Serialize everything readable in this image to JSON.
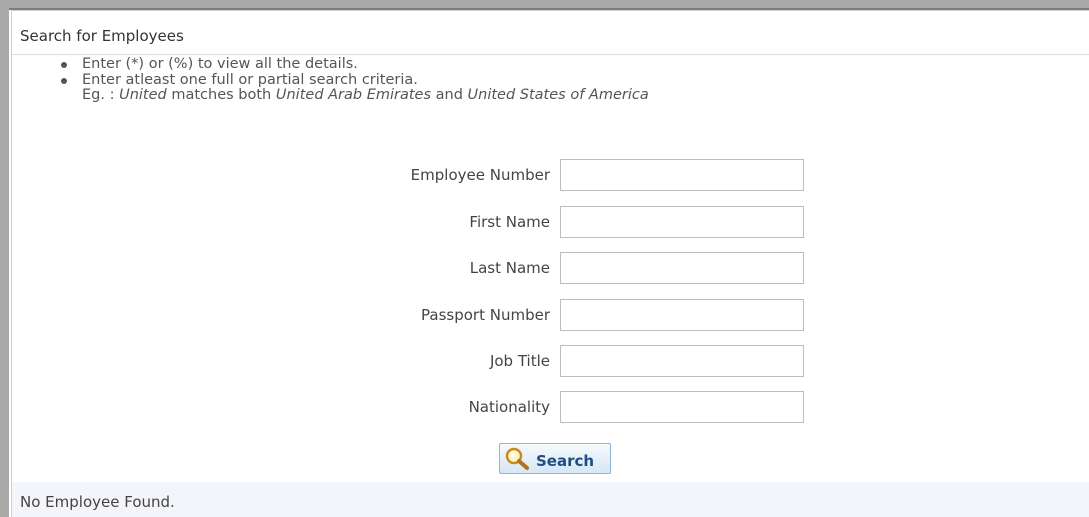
{
  "panel": {
    "title": "Search for Employees"
  },
  "instructions": {
    "items": [
      "Enter (*) or (%) to view all the details.",
      "Enter atleast one full or partial search criteria."
    ],
    "example": {
      "prefix": "Eg. : ",
      "term": "United",
      "middle": " matches both ",
      "match1": "United Arab Emirates",
      "and": " and ",
      "match2": "United States of America"
    }
  },
  "form": {
    "fields": [
      {
        "label": "Employee Number",
        "value": ""
      },
      {
        "label": "First Name",
        "value": ""
      },
      {
        "label": "Last Name",
        "value": ""
      },
      {
        "label": "Passport Number",
        "value": ""
      },
      {
        "label": "Job Title",
        "value": ""
      },
      {
        "label": "Nationality",
        "value": ""
      }
    ]
  },
  "search_button": {
    "label": "Search",
    "icon": "magnifier-icon"
  },
  "status": {
    "message": "No Employee Found."
  },
  "colors": {
    "button_text": "#1c4f84",
    "button_border": "#8eb5d6",
    "status_background": "#f4f5fb",
    "frame_border": "#a9a9a9"
  }
}
